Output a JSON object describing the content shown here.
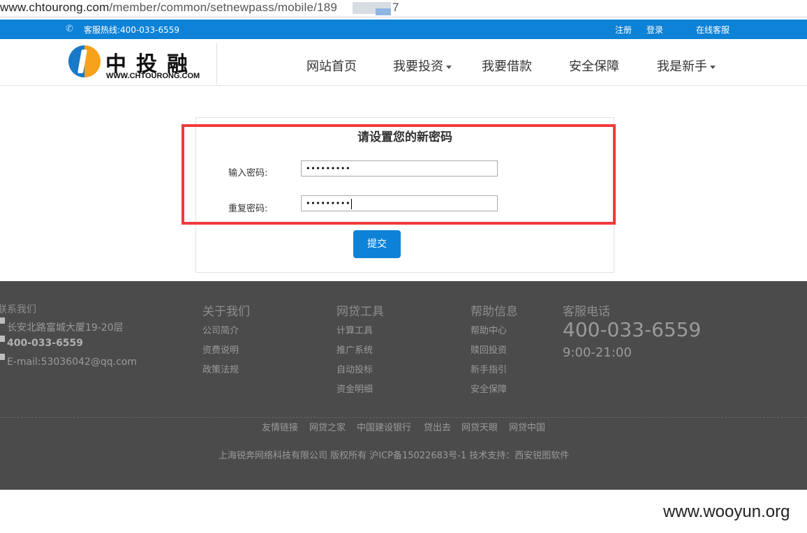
{
  "address_bar": {
    "host": "www.chtourong.com",
    "path": "/member/common/setnewpass/mobile/189",
    "tail": "7"
  },
  "topbar": {
    "hotline": "客服热线:400-033-6559",
    "register": "注册",
    "login": "登录",
    "online_service": "在线客服"
  },
  "logo": {
    "cn": "中投融",
    "en": "WWW.CHTOURONG.COM"
  },
  "nav": [
    "网站首页",
    "我要投资",
    "我要借款",
    "安全保障",
    "我是新手"
  ],
  "form": {
    "title": "请设置您的新密码",
    "password_label": "输入密码:",
    "password_value": "•••••••••",
    "repeat_label": "重复密码:",
    "repeat_value": "•••••••••",
    "submit": "提交"
  },
  "footer": {
    "contact": {
      "title": "联系我们",
      "address": "长安北路富城大厦19-20层",
      "phone": "400-033-6559",
      "email": "E-mail:53036042@qq.com"
    },
    "about": {
      "title": "关于我们",
      "links": [
        "公司简介",
        "资费说明",
        "政策法规"
      ]
    },
    "tools": {
      "title": "网贷工具",
      "links": [
        "计算工具",
        "推广系统",
        "自动投标",
        "资金明细"
      ]
    },
    "help": {
      "title": "帮助信息",
      "links": [
        "帮助中心",
        "赎回投资",
        "新手指引",
        "安全保障"
      ]
    },
    "service": {
      "title": "客服电话",
      "phone": "400-033-6559",
      "hours": "9:00-21:00"
    },
    "friend_links": [
      "友情链接",
      "网贷之家",
      "中国建设银行",
      "贷出去",
      "网贷天眼",
      "网贷中国"
    ],
    "copyright": "上海锐奔网络科技有限公司 版权所有 沪ICP备15022683号-1 技术支持：西安锐图软件"
  },
  "watermark": "www.wooyun.org",
  "colors": {
    "brand_blue": "#0d82d6",
    "highlight_red": "#ef3b3b",
    "footer_bg": "#4b4b4b"
  }
}
